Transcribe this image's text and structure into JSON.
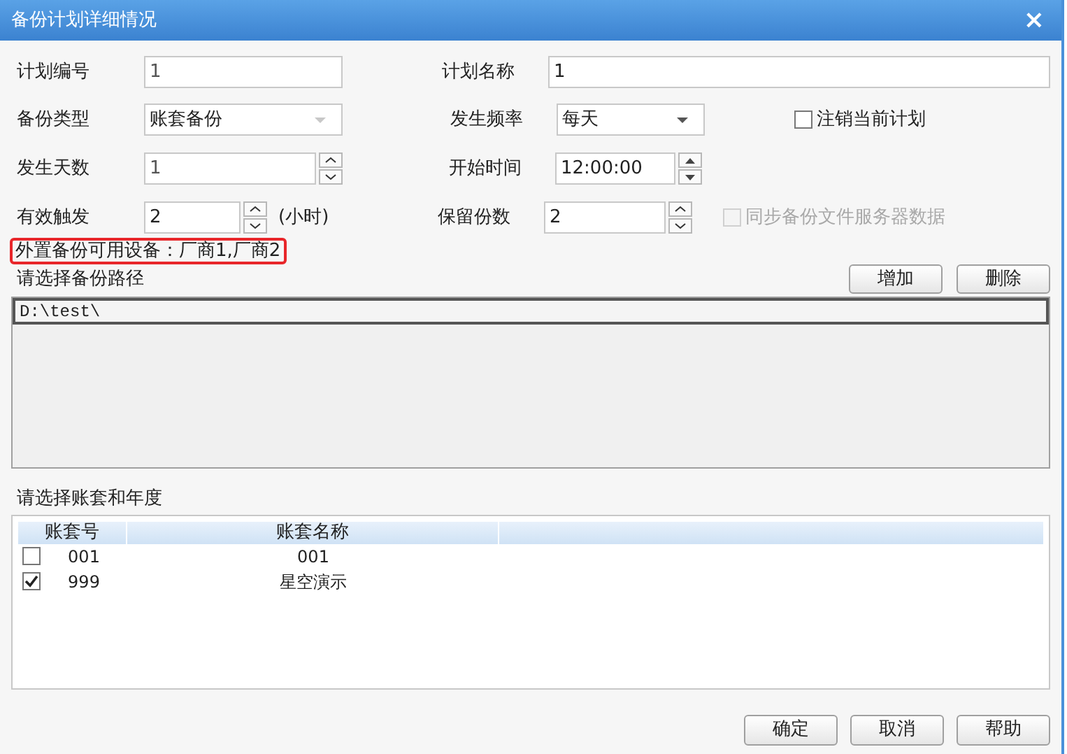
{
  "window": {
    "title": "备份计划详细情况",
    "close": "×"
  },
  "form": {
    "plan_no": {
      "label": "计划编号",
      "value": "1"
    },
    "plan_name": {
      "label": "计划名称",
      "value": "1"
    },
    "backup_type": {
      "label": "备份类型",
      "value": "账套备份",
      "disabled": true
    },
    "frequency": {
      "label": "发生频率",
      "value": "每天",
      "disabled": false
    },
    "cancel_plan": {
      "label": "注销当前计划",
      "checked": false,
      "disabled": false
    },
    "days": {
      "label": "发生天数",
      "value": "1"
    },
    "start_time": {
      "label": "开始时间",
      "value": "12:00:00"
    },
    "trigger": {
      "label": "有效触发",
      "value": "2",
      "unit": "(小时)"
    },
    "keep": {
      "label": "保留份数",
      "value": "2"
    },
    "sync": {
      "label": "同步备份文件服务器数据",
      "checked": false,
      "disabled": true
    }
  },
  "devices_note": "外置备份可用设备：厂商1,厂商2",
  "paths": {
    "label": "请选择备份路径",
    "buttons": [
      "增加",
      "删除"
    ],
    "items": [
      {
        "text": "D:\\test\\",
        "selected": true
      }
    ]
  },
  "accounts": {
    "label": "请选择账套和年度",
    "columns": [
      "账套号",
      "账套名称"
    ],
    "rows": [
      {
        "cells": [
          "001",
          "001"
        ],
        "checked": false
      },
      {
        "cells": [
          "999",
          "星空演示"
        ],
        "checked": true
      }
    ]
  },
  "buttons": [
    "确定",
    "取消",
    "帮助"
  ]
}
